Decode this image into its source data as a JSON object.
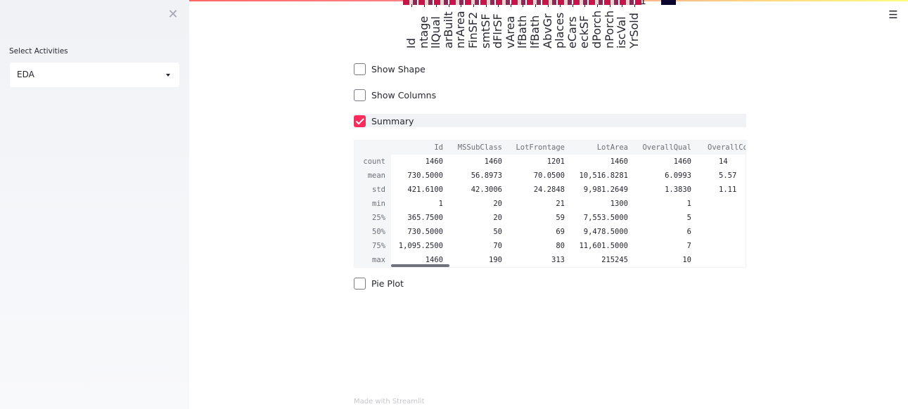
{
  "sidebar": {
    "close_icon": "close-icon",
    "select_label": "Select Activities",
    "select_value": "EDA"
  },
  "header": {
    "menu_icon": "hamburger-menu-icon",
    "menu_glyph": "☰",
    "close_glyph": "✕"
  },
  "heatmap": {
    "labels": [
      "Id",
      "ntage",
      "llQual",
      "arBuilt",
      "nrArea",
      "FinSF2",
      "smtSF",
      "dFlrSF",
      "vArea",
      "lfBath",
      "lfBath",
      "AbvGr",
      "places",
      "eCars",
      "eckSF",
      "dPorch",
      "nPorch",
      "iscVal",
      "YrSold"
    ],
    "colorbar_tick": "1"
  },
  "checkboxes": [
    {
      "label": "Show Shape",
      "checked": false
    },
    {
      "label": "Show Columns",
      "checked": false
    },
    {
      "label": "Summary",
      "checked": true
    },
    {
      "label": "Pie Plot",
      "checked": false
    }
  ],
  "summary": {
    "columns": [
      "Id",
      "MSSubClass",
      "LotFrontage",
      "LotArea",
      "OverallQual",
      "OverallCo"
    ],
    "rows": [
      {
        "name": "count",
        "values": [
          "1460",
          "1460",
          "1201",
          "1460",
          "1460",
          "14"
        ]
      },
      {
        "name": "mean",
        "values": [
          "730.5000",
          "56.8973",
          "70.0500",
          "10,516.8281",
          "6.0993",
          "5.57"
        ]
      },
      {
        "name": "std",
        "values": [
          "421.6100",
          "42.3006",
          "24.2848",
          "9,981.2649",
          "1.3830",
          "1.11"
        ]
      },
      {
        "name": "min",
        "values": [
          "1",
          "20",
          "21",
          "1300",
          "1",
          ""
        ]
      },
      {
        "name": "25%",
        "values": [
          "365.7500",
          "20",
          "59",
          "7,553.5000",
          "5",
          ""
        ]
      },
      {
        "name": "50%",
        "values": [
          "730.5000",
          "50",
          "69",
          "9,478.5000",
          "6",
          ""
        ]
      },
      {
        "name": "75%",
        "values": [
          "1,095.2500",
          "70",
          "80",
          "11,601.5000",
          "7",
          ""
        ]
      },
      {
        "name": "max",
        "values": [
          "1460",
          "190",
          "313",
          "215245",
          "10",
          ""
        ]
      }
    ]
  },
  "footer": {
    "text": "Made with Streamlit"
  }
}
